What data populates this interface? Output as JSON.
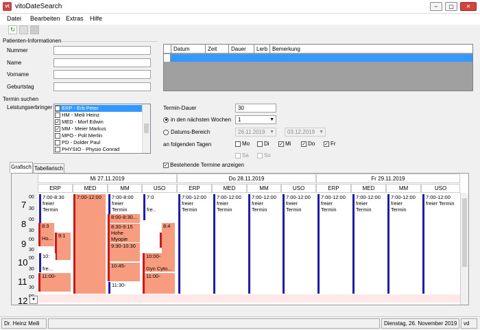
{
  "window": {
    "title": "vitoDateSearch",
    "icon_text": "vt"
  },
  "menu": [
    "Datei",
    "Bearbeiten",
    "Extras",
    "Hilfe"
  ],
  "patient": {
    "section": "Patienten-Informationen",
    "nummer_label": "Nummer",
    "name_label": "Name",
    "vorname_label": "Vorname",
    "geburtstag_label": "Geburtstag"
  },
  "appointments_grid": {
    "columns": [
      "Datum",
      "Zeit",
      "Dauer",
      "Lerb",
      "Bemerkung"
    ]
  },
  "search": {
    "section": "Termin suchen",
    "providers_label": "Leistungserbringer",
    "providers": [
      {
        "label": "ERP - Erb Peter",
        "checked": true,
        "selected": true
      },
      {
        "label": "HM - Meili Heinz",
        "checked": false,
        "selected": false
      },
      {
        "label": "MED - Morf Edwin",
        "checked": true,
        "selected": false
      },
      {
        "label": "MM - Meier Markus",
        "checked": true,
        "selected": false
      },
      {
        "label": "MPO - Polt Merlin",
        "checked": false,
        "selected": false
      },
      {
        "label": "PD - Dolder Paul",
        "checked": false,
        "selected": false
      },
      {
        "label": "PHYSIO - Physio Conrad",
        "checked": false,
        "selected": false
      }
    ],
    "duration_label": "Termin-Dauer",
    "duration_value": "30",
    "weeks_label": "in den nächsten Wochen",
    "weeks_value": "1",
    "range_label": "Datums-Bereich",
    "range_from": "26.11.2019",
    "range_to": "03.12.2019",
    "days_label": "an folgenden Tagen",
    "days": [
      {
        "label": "Mo",
        "checked": false
      },
      {
        "label": "Di",
        "checked": false
      },
      {
        "label": "Mi",
        "checked": true
      },
      {
        "label": "Do",
        "checked": true
      },
      {
        "label": "Fr",
        "checked": true
      },
      {
        "label": "Sa",
        "checked": false
      },
      {
        "label": "So",
        "checked": false
      }
    ],
    "show_existing_label": "Bestehende Termine anzeigen"
  },
  "tabs": [
    "Grafisch",
    "Tabellarisch"
  ],
  "calendar": {
    "days": [
      "Mi 27.11.2019",
      "Do 28.11.2019",
      "Fr 29.11.2019"
    ],
    "columns": [
      "ERP",
      "MED",
      "MM",
      "USO"
    ],
    "hours": [
      "7",
      "8",
      "9",
      "10",
      "11",
      "12"
    ],
    "half": [
      "00",
      "30"
    ],
    "texts": {
      "free_time": "7:00-12:00",
      "free_label_1": "freier",
      "free_label_2": "Termin",
      "erp_free": "7:00-8:30",
      "mm_free": "7:00-8:00",
      "uso_free_time": "7:0",
      "uso_free_label": "fre...",
      "med_booked": "7:00-12:00",
      "erp_83": "8:3",
      "erp_ho": "Ho...",
      "erp_91": "9:1",
      "erp_10": "10:",
      "erp_fre": "fre...",
      "erp_11": "11:00-",
      "mm_800": "8:00-8:30...",
      "mm_830": "8:30-9:15",
      "mm_hohe": "Hohe",
      "mm_myopie": "Myopie",
      "mm_930": "9:30-10:30",
      "mm_1045": "10:45-",
      "mm_1130": "11:30-",
      "uso_84": "8:4",
      "uso_1000": "10:00-",
      "uso_gyn": "Gyn Cyto...",
      "uso_1100": "11:00-"
    }
  },
  "status": {
    "user": "Dr. Heinz Meili",
    "date": "Dienstag, 26. November 2019",
    "version": "vd"
  }
}
